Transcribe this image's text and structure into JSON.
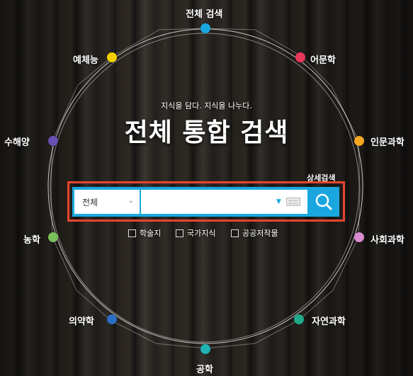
{
  "header": {
    "tagline": "지식을 담다. 지식을 나누다.",
    "title": "전체 통합 검색"
  },
  "categories": [
    {
      "label": "전체 검색",
      "color": "#1aa7e0"
    },
    {
      "label": "어문학",
      "color": "#e8385a"
    },
    {
      "label": "인문과학",
      "color": "#f5a623"
    },
    {
      "label": "사회과학",
      "color": "#d98bd0"
    },
    {
      "label": "자연과학",
      "color": "#1fa98a"
    },
    {
      "label": "공학",
      "color": "#1fb3b3"
    },
    {
      "label": "의약학",
      "color": "#2a6fc4"
    },
    {
      "label": "농학",
      "color": "#7bc05a"
    },
    {
      "label": "수해양",
      "color": "#6a4fb5"
    },
    {
      "label": "예체능",
      "color": "#f5d000"
    }
  ],
  "search": {
    "advanced_label": "상세검색",
    "scope_value": "전체",
    "query_value": "",
    "query_placeholder": "",
    "accent_color": "#1aa7e0",
    "highlight_color": "#e5452f"
  },
  "filters": [
    {
      "label": "학술지",
      "checked": false
    },
    {
      "label": "국가지식",
      "checked": false
    },
    {
      "label": "공공저작물",
      "checked": false
    }
  ]
}
